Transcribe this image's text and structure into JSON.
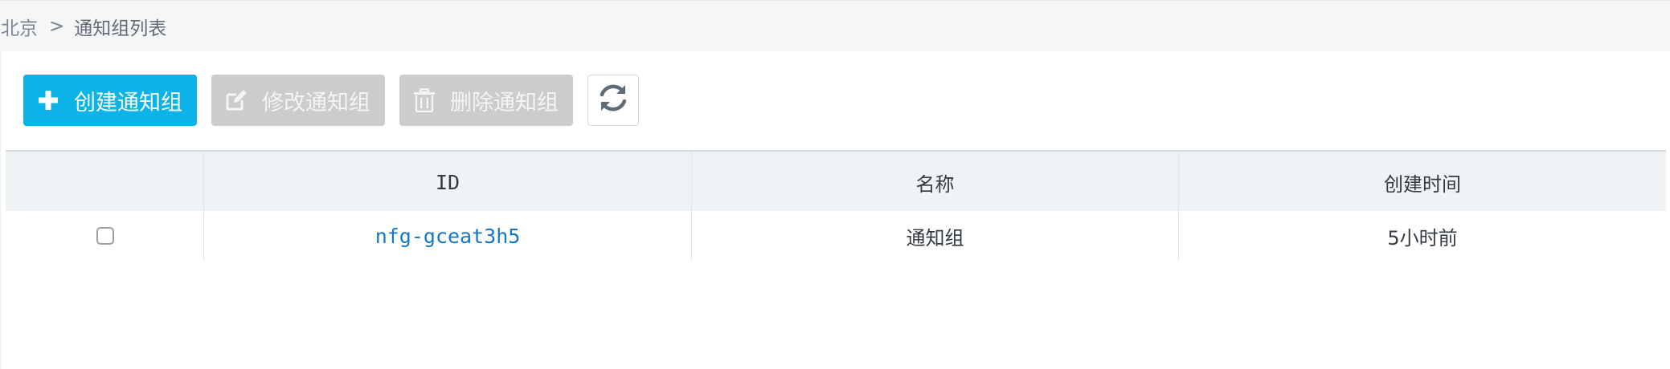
{
  "breadcrumb": {
    "root": "北京",
    "separator": ">",
    "current": "通知组列表"
  },
  "toolbar": {
    "create_label": "创建通知组",
    "create_icon": "plus-icon",
    "edit_label": "修改通知组",
    "edit_icon": "edit-icon",
    "delete_label": "删除通知组",
    "delete_icon": "trash-icon",
    "refresh_icon": "refresh-icon",
    "colors": {
      "primary": "#0bb3e6",
      "disabled": "#cccccc"
    }
  },
  "table": {
    "columns": [
      "",
      "ID",
      "名称",
      "创建时间"
    ],
    "rows": [
      {
        "checked": false,
        "id": "nfg-gceat3h5",
        "name": "通知组",
        "created": "5小时前"
      }
    ],
    "link_color": "#1677c9"
  }
}
